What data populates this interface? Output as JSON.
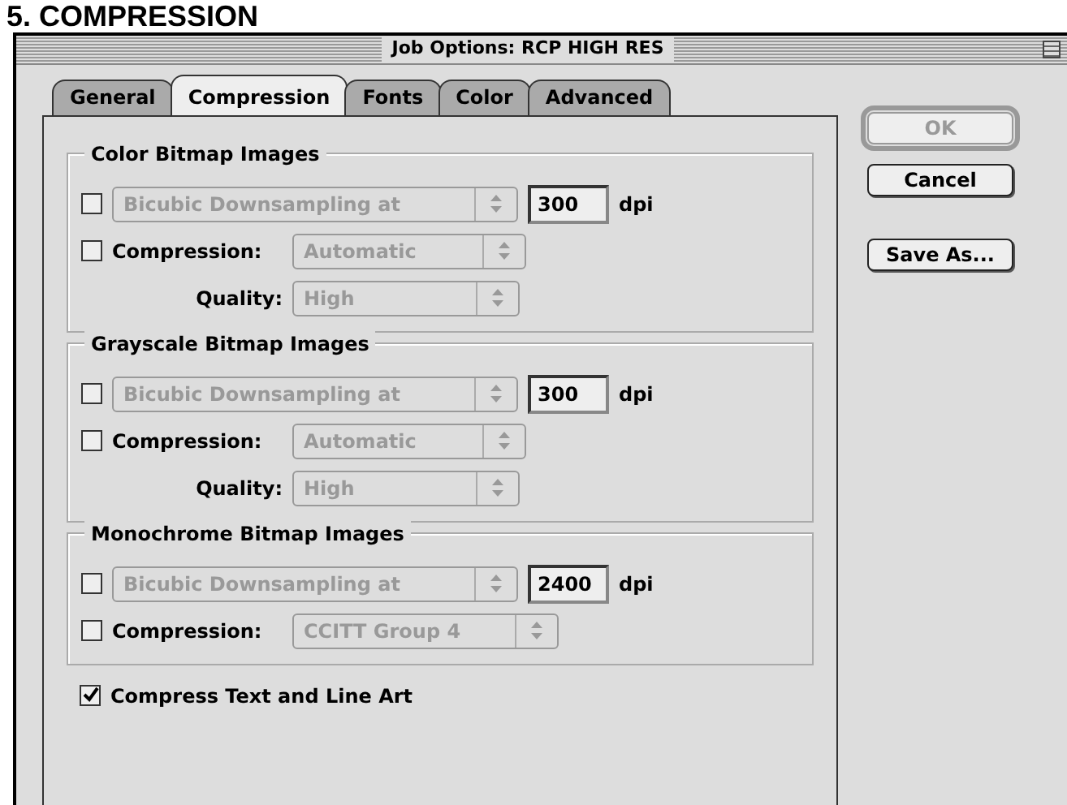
{
  "page_heading": "5. COMPRESSION",
  "window": {
    "title": "Job Options: RCP HIGH RES"
  },
  "tabs": [
    {
      "label": "General",
      "selected": false
    },
    {
      "label": "Compression",
      "selected": true
    },
    {
      "label": "Fonts",
      "selected": false
    },
    {
      "label": "Color",
      "selected": false
    },
    {
      "label": "Advanced",
      "selected": false
    }
  ],
  "groups": [
    {
      "title": "Color Bitmap Images",
      "rows": [
        {
          "kind": "downsample",
          "checked": false,
          "method": "Bicubic Downsampling at",
          "resolution": "300",
          "unit": "dpi"
        },
        {
          "kind": "compression",
          "checked": false,
          "label": "Compression:",
          "value": "Automatic"
        },
        {
          "kind": "quality",
          "label": "Quality:",
          "value": "High"
        }
      ]
    },
    {
      "title": "Grayscale Bitmap Images",
      "rows": [
        {
          "kind": "downsample",
          "checked": false,
          "method": "Bicubic Downsampling at",
          "resolution": "300",
          "unit": "dpi"
        },
        {
          "kind": "compression",
          "checked": false,
          "label": "Compression:",
          "value": "Automatic"
        },
        {
          "kind": "quality",
          "label": "Quality:",
          "value": "High"
        }
      ]
    },
    {
      "title": "Monochrome Bitmap Images",
      "rows": [
        {
          "kind": "downsample",
          "checked": false,
          "method": "Bicubic Downsampling at",
          "resolution": "2400",
          "unit": "dpi"
        },
        {
          "kind": "compression",
          "checked": false,
          "label": "Compression:",
          "value": "CCITT Group 4"
        }
      ]
    }
  ],
  "compress_text": {
    "label": "Compress Text and Line Art",
    "checked": true
  },
  "buttons": [
    {
      "label": "OK",
      "disabled": true,
      "default": true
    },
    {
      "label": "Cancel",
      "disabled": false,
      "default": false
    },
    {
      "label": "Save As...",
      "disabled": false,
      "default": false
    }
  ]
}
